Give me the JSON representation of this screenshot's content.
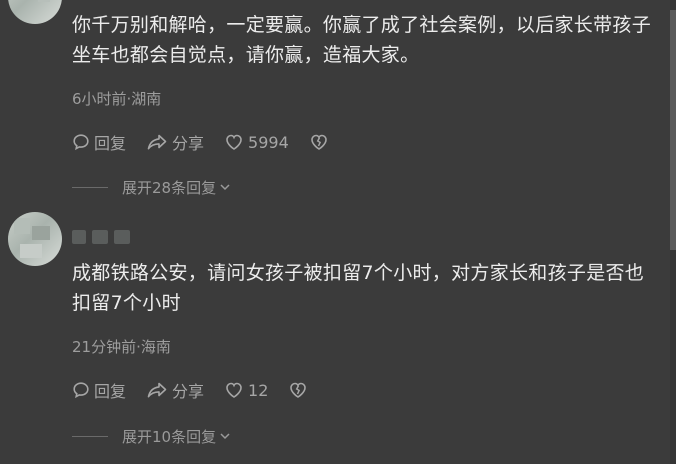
{
  "comments": [
    {
      "text": "你千万别和解哈，一定要赢。你赢了成了社会案例，以后家长带孩子坐车也都会自觉点，请你赢，造福大家。",
      "time_location": "6小时前·湖南",
      "reply_label": "回复",
      "share_label": "分享",
      "like_count": "5994",
      "expand_replies": "展开28条回复"
    },
    {
      "text": "成都铁路公安，请问女孩子被扣留7个小时，对方家长和孩子是否也扣留7个小时",
      "time_location": "21分钟前·海南",
      "reply_label": "回复",
      "share_label": "分享",
      "like_count": "12",
      "expand_replies": "展开10条回复"
    }
  ],
  "icons": {
    "reply": "speech-bubble-icon",
    "share": "share-arrow-icon",
    "like": "heart-icon",
    "dislike": "broken-heart-icon",
    "expand": "chevron-down-icon"
  },
  "colors": {
    "background": "#3b3b3b",
    "text": "#ececec",
    "muted": "#9d9d9d"
  }
}
